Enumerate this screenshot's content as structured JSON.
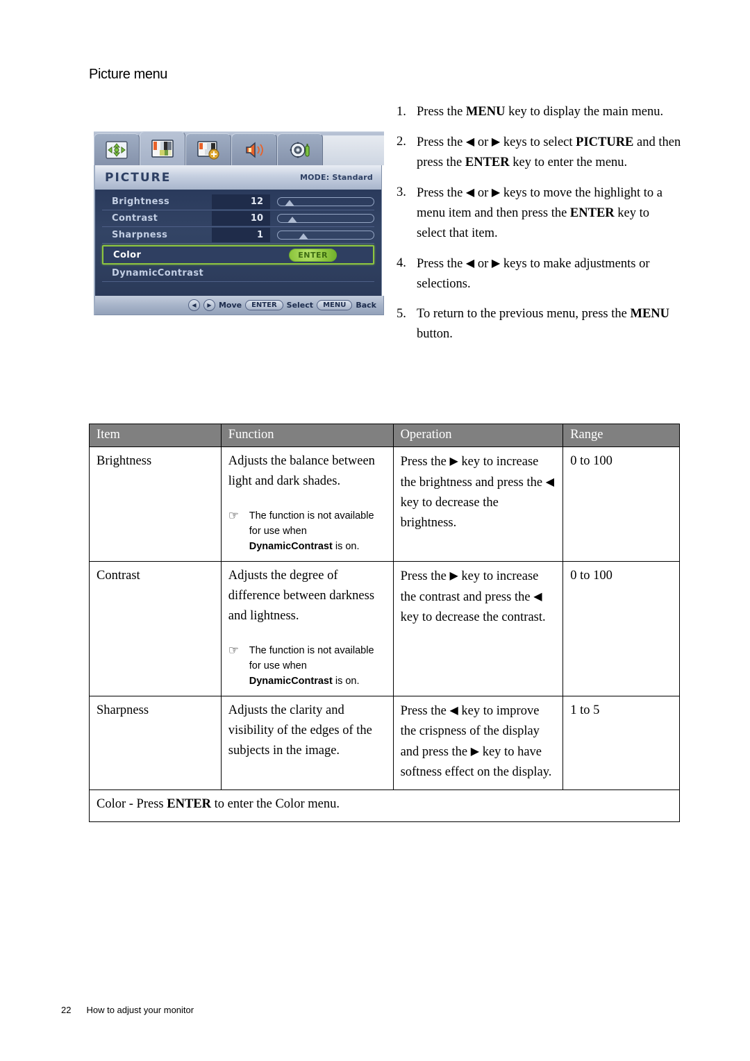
{
  "heading": "Picture menu",
  "osd": {
    "tabs": [
      {
        "name": "display-tab",
        "icon": "move-arrows-icon",
        "active": false
      },
      {
        "name": "picture-tab",
        "icon": "color-bars-icon",
        "active": true
      },
      {
        "name": "picture-advanced-tab",
        "icon": "color-bars-plus-icon",
        "active": false
      },
      {
        "name": "audio-tab",
        "icon": "speaker-icon",
        "active": false
      },
      {
        "name": "system-tab",
        "icon": "gear-icon",
        "active": false
      }
    ],
    "title": "PICTURE",
    "mode": "MODE: Standard",
    "rows": [
      {
        "label": "Brightness",
        "value": "12",
        "slider_pct": 12
      },
      {
        "label": "Contrast",
        "value": "10",
        "slider_pct": 10
      },
      {
        "label": "Sharpness",
        "value": "1",
        "slider_pct": 35
      }
    ],
    "color_row": {
      "label": "Color",
      "button": "ENTER"
    },
    "dynamic_row": {
      "label": "DynamicContrast"
    },
    "footer": {
      "left_arrow": "◀",
      "right_arrow": "▶",
      "move": "Move",
      "enter": "ENTER",
      "select": "Select",
      "menu": "MENU",
      "back": "Back"
    },
    "colors": {
      "highlight_green": "#8ec63f",
      "body_navy": "#2f3f61",
      "chrome_blue": "#a7b4c9"
    }
  },
  "steps": [
    {
      "num": "1.",
      "parts": [
        {
          "t": "Press the ",
          "s": "n"
        },
        {
          "t": "MENU",
          "s": "b"
        },
        {
          "t": " key to display the main menu.",
          "s": "n"
        }
      ]
    },
    {
      "num": "2.",
      "parts": [
        {
          "t": "Press the ",
          "s": "n"
        },
        {
          "t": "◀",
          "s": "tri"
        },
        {
          "t": " or ",
          "s": "n"
        },
        {
          "t": "▶",
          "s": "tri"
        },
        {
          "t": " keys to select ",
          "s": "n"
        },
        {
          "t": "PICTURE",
          "s": "b"
        },
        {
          "t": " and then press the ",
          "s": "n"
        },
        {
          "t": "ENTER",
          "s": "b"
        },
        {
          "t": " key to enter the menu.",
          "s": "n"
        }
      ]
    },
    {
      "num": "3.",
      "parts": [
        {
          "t": "Press the ",
          "s": "n"
        },
        {
          "t": "◀",
          "s": "tri"
        },
        {
          "t": " or ",
          "s": "n"
        },
        {
          "t": "▶",
          "s": "tri"
        },
        {
          "t": " keys to move the highlight to a menu item and then press the ",
          "s": "n"
        },
        {
          "t": "ENTER",
          "s": "b"
        },
        {
          "t": " key to select that item.",
          "s": "n"
        }
      ]
    },
    {
      "num": "4.",
      "parts": [
        {
          "t": "Press the ",
          "s": "n"
        },
        {
          "t": "◀",
          "s": "tri"
        },
        {
          "t": " or ",
          "s": "n"
        },
        {
          "t": "▶",
          "s": "tri"
        },
        {
          "t": " keys to make adjustments or selections.",
          "s": "n"
        }
      ]
    },
    {
      "num": "5.",
      "parts": [
        {
          "t": "To return to the previous menu, press the ",
          "s": "n"
        },
        {
          "t": "MENU",
          "s": "b"
        },
        {
          "t": " button.",
          "s": "n"
        }
      ]
    }
  ],
  "table": {
    "headers": [
      "Item",
      "Function",
      "Operation",
      "Range"
    ],
    "rows": [
      {
        "item": "Brightness",
        "function": "Adjusts the balance between light and dark shades.",
        "note": [
          {
            "t": "The function is not available for use when ",
            "s": "n"
          },
          {
            "t": "DynamicContrast",
            "s": "b"
          },
          {
            "t": " is on.",
            "s": "n"
          }
        ],
        "operation": [
          {
            "t": "Press the ",
            "s": "n"
          },
          {
            "t": "▶",
            "s": "tri"
          },
          {
            "t": " key to increase the brightness and press the ",
            "s": "n"
          },
          {
            "t": "◀",
            "s": "tri"
          },
          {
            "t": " key to decrease the brightness.",
            "s": "n"
          }
        ],
        "range": "0 to 100"
      },
      {
        "item": "Contrast",
        "function": "Adjusts the degree of difference between darkness and lightness.",
        "note": [
          {
            "t": "The function is not available for use when ",
            "s": "n"
          },
          {
            "t": "DynamicContrast",
            "s": "b"
          },
          {
            "t": " is on.",
            "s": "n"
          }
        ],
        "operation": [
          {
            "t": "Press the ",
            "s": "n"
          },
          {
            "t": "▶",
            "s": "tri"
          },
          {
            "t": " key to increase the contrast and press the ",
            "s": "n"
          },
          {
            "t": "◀",
            "s": "tri"
          },
          {
            "t": " key to decrease the contrast.",
            "s": "n"
          }
        ],
        "range": "0 to 100"
      },
      {
        "item": "Sharpness",
        "function": "Adjusts the clarity and visibility of the edges of the subjects in the image.",
        "note": null,
        "operation": [
          {
            "t": "Press the ",
            "s": "n"
          },
          {
            "t": "◀",
            "s": "tri"
          },
          {
            "t": " key to improve the crispness of the display and press the ",
            "s": "n"
          },
          {
            "t": "▶",
            "s": "tri"
          },
          {
            "t": " key to have softness effect on the display.",
            "s": "n"
          }
        ],
        "range": "1 to 5"
      }
    ],
    "color_row": [
      {
        "t": "Color",
        "s": "n"
      },
      {
        "t": " - Press ",
        "s": "n"
      },
      {
        "t": "ENTER",
        "s": "b"
      },
      {
        "t": " to enter the ",
        "s": "n"
      },
      {
        "t": "Color",
        "s": "n"
      },
      {
        "t": " menu.",
        "s": "n"
      }
    ],
    "note_icon": "☞"
  },
  "footer": {
    "page": "22",
    "section": "How to adjust your monitor"
  }
}
